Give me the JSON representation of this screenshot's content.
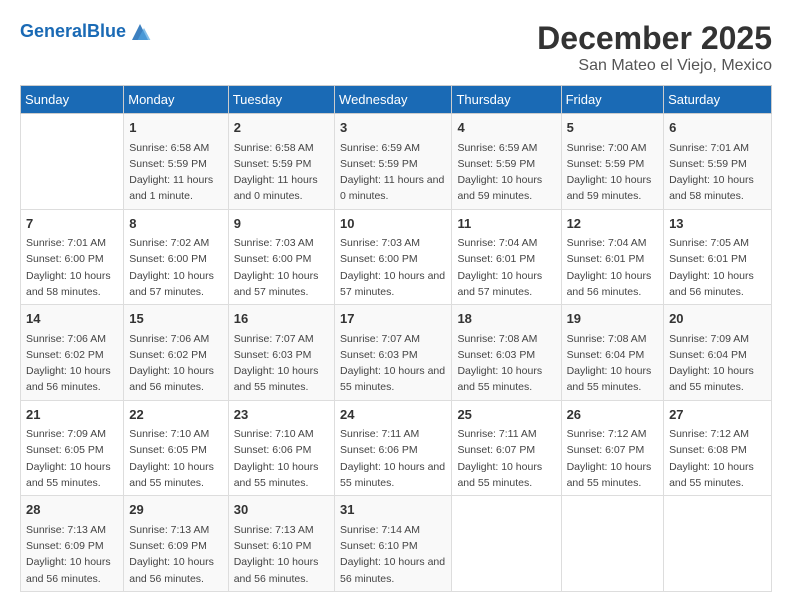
{
  "logo": {
    "line1": "General",
    "line2": "Blue"
  },
  "title": "December 2025",
  "location": "San Mateo el Viejo, Mexico",
  "days_of_week": [
    "Sunday",
    "Monday",
    "Tuesday",
    "Wednesday",
    "Thursday",
    "Friday",
    "Saturday"
  ],
  "weeks": [
    [
      {
        "day": "",
        "sunrise": "",
        "sunset": "",
        "daylight": ""
      },
      {
        "day": "1",
        "sunrise": "Sunrise: 6:58 AM",
        "sunset": "Sunset: 5:59 PM",
        "daylight": "Daylight: 11 hours and 1 minute."
      },
      {
        "day": "2",
        "sunrise": "Sunrise: 6:58 AM",
        "sunset": "Sunset: 5:59 PM",
        "daylight": "Daylight: 11 hours and 0 minutes."
      },
      {
        "day": "3",
        "sunrise": "Sunrise: 6:59 AM",
        "sunset": "Sunset: 5:59 PM",
        "daylight": "Daylight: 11 hours and 0 minutes."
      },
      {
        "day": "4",
        "sunrise": "Sunrise: 6:59 AM",
        "sunset": "Sunset: 5:59 PM",
        "daylight": "Daylight: 10 hours and 59 minutes."
      },
      {
        "day": "5",
        "sunrise": "Sunrise: 7:00 AM",
        "sunset": "Sunset: 5:59 PM",
        "daylight": "Daylight: 10 hours and 59 minutes."
      },
      {
        "day": "6",
        "sunrise": "Sunrise: 7:01 AM",
        "sunset": "Sunset: 5:59 PM",
        "daylight": "Daylight: 10 hours and 58 minutes."
      }
    ],
    [
      {
        "day": "7",
        "sunrise": "Sunrise: 7:01 AM",
        "sunset": "Sunset: 6:00 PM",
        "daylight": "Daylight: 10 hours and 58 minutes."
      },
      {
        "day": "8",
        "sunrise": "Sunrise: 7:02 AM",
        "sunset": "Sunset: 6:00 PM",
        "daylight": "Daylight: 10 hours and 57 minutes."
      },
      {
        "day": "9",
        "sunrise": "Sunrise: 7:03 AM",
        "sunset": "Sunset: 6:00 PM",
        "daylight": "Daylight: 10 hours and 57 minutes."
      },
      {
        "day": "10",
        "sunrise": "Sunrise: 7:03 AM",
        "sunset": "Sunset: 6:00 PM",
        "daylight": "Daylight: 10 hours and 57 minutes."
      },
      {
        "day": "11",
        "sunrise": "Sunrise: 7:04 AM",
        "sunset": "Sunset: 6:01 PM",
        "daylight": "Daylight: 10 hours and 57 minutes."
      },
      {
        "day": "12",
        "sunrise": "Sunrise: 7:04 AM",
        "sunset": "Sunset: 6:01 PM",
        "daylight": "Daylight: 10 hours and 56 minutes."
      },
      {
        "day": "13",
        "sunrise": "Sunrise: 7:05 AM",
        "sunset": "Sunset: 6:01 PM",
        "daylight": "Daylight: 10 hours and 56 minutes."
      }
    ],
    [
      {
        "day": "14",
        "sunrise": "Sunrise: 7:06 AM",
        "sunset": "Sunset: 6:02 PM",
        "daylight": "Daylight: 10 hours and 56 minutes."
      },
      {
        "day": "15",
        "sunrise": "Sunrise: 7:06 AM",
        "sunset": "Sunset: 6:02 PM",
        "daylight": "Daylight: 10 hours and 56 minutes."
      },
      {
        "day": "16",
        "sunrise": "Sunrise: 7:07 AM",
        "sunset": "Sunset: 6:03 PM",
        "daylight": "Daylight: 10 hours and 55 minutes."
      },
      {
        "day": "17",
        "sunrise": "Sunrise: 7:07 AM",
        "sunset": "Sunset: 6:03 PM",
        "daylight": "Daylight: 10 hours and 55 minutes."
      },
      {
        "day": "18",
        "sunrise": "Sunrise: 7:08 AM",
        "sunset": "Sunset: 6:03 PM",
        "daylight": "Daylight: 10 hours and 55 minutes."
      },
      {
        "day": "19",
        "sunrise": "Sunrise: 7:08 AM",
        "sunset": "Sunset: 6:04 PM",
        "daylight": "Daylight: 10 hours and 55 minutes."
      },
      {
        "day": "20",
        "sunrise": "Sunrise: 7:09 AM",
        "sunset": "Sunset: 6:04 PM",
        "daylight": "Daylight: 10 hours and 55 minutes."
      }
    ],
    [
      {
        "day": "21",
        "sunrise": "Sunrise: 7:09 AM",
        "sunset": "Sunset: 6:05 PM",
        "daylight": "Daylight: 10 hours and 55 minutes."
      },
      {
        "day": "22",
        "sunrise": "Sunrise: 7:10 AM",
        "sunset": "Sunset: 6:05 PM",
        "daylight": "Daylight: 10 hours and 55 minutes."
      },
      {
        "day": "23",
        "sunrise": "Sunrise: 7:10 AM",
        "sunset": "Sunset: 6:06 PM",
        "daylight": "Daylight: 10 hours and 55 minutes."
      },
      {
        "day": "24",
        "sunrise": "Sunrise: 7:11 AM",
        "sunset": "Sunset: 6:06 PM",
        "daylight": "Daylight: 10 hours and 55 minutes."
      },
      {
        "day": "25",
        "sunrise": "Sunrise: 7:11 AM",
        "sunset": "Sunset: 6:07 PM",
        "daylight": "Daylight: 10 hours and 55 minutes."
      },
      {
        "day": "26",
        "sunrise": "Sunrise: 7:12 AM",
        "sunset": "Sunset: 6:07 PM",
        "daylight": "Daylight: 10 hours and 55 minutes."
      },
      {
        "day": "27",
        "sunrise": "Sunrise: 7:12 AM",
        "sunset": "Sunset: 6:08 PM",
        "daylight": "Daylight: 10 hours and 55 minutes."
      }
    ],
    [
      {
        "day": "28",
        "sunrise": "Sunrise: 7:13 AM",
        "sunset": "Sunset: 6:09 PM",
        "daylight": "Daylight: 10 hours and 56 minutes."
      },
      {
        "day": "29",
        "sunrise": "Sunrise: 7:13 AM",
        "sunset": "Sunset: 6:09 PM",
        "daylight": "Daylight: 10 hours and 56 minutes."
      },
      {
        "day": "30",
        "sunrise": "Sunrise: 7:13 AM",
        "sunset": "Sunset: 6:10 PM",
        "daylight": "Daylight: 10 hours and 56 minutes."
      },
      {
        "day": "31",
        "sunrise": "Sunrise: 7:14 AM",
        "sunset": "Sunset: 6:10 PM",
        "daylight": "Daylight: 10 hours and 56 minutes."
      },
      {
        "day": "",
        "sunrise": "",
        "sunset": "",
        "daylight": ""
      },
      {
        "day": "",
        "sunrise": "",
        "sunset": "",
        "daylight": ""
      },
      {
        "day": "",
        "sunrise": "",
        "sunset": "",
        "daylight": ""
      }
    ]
  ]
}
